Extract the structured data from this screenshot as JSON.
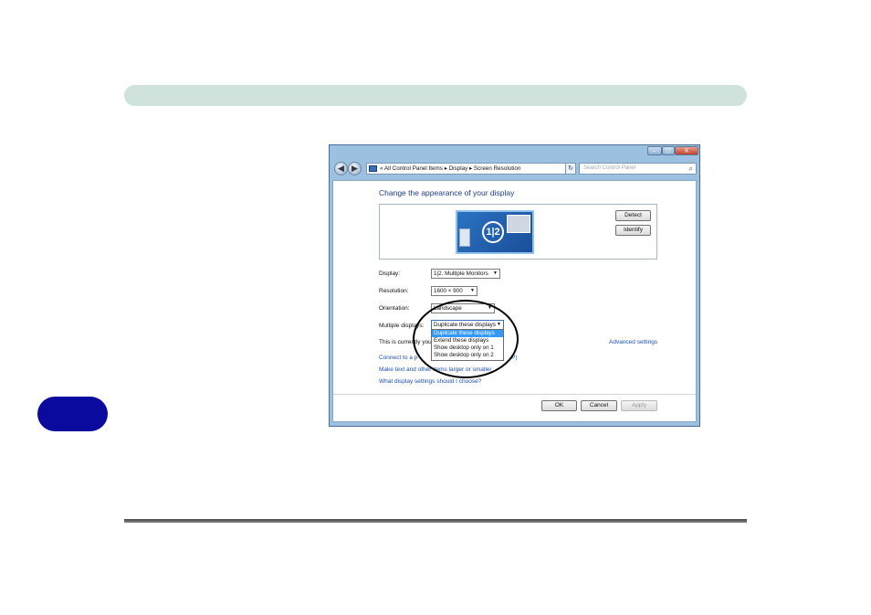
{
  "window": {
    "caption_buttons": {
      "minimize": "–",
      "maximize": "□",
      "close": "X"
    },
    "address_bar": {
      "back": "◀",
      "forward": "▶",
      "path": "«  All Control Panel Items  ▸  Display  ▸  Screen Resolution",
      "dropdown": "▾",
      "refresh": "↻",
      "search_placeholder": "Search Control Panel",
      "search_icon": "⌕"
    },
    "page_title": "Change the appearance of your display",
    "preview": {
      "badge": "1|2"
    },
    "buttons": {
      "detect": "Detect",
      "identify": "Identify",
      "ok": "OK",
      "cancel": "Cancel",
      "apply": "Apply"
    },
    "display": {
      "label": "Display:",
      "value": "1|2. Multiple Monitors"
    },
    "resolution": {
      "label": "Resolution:",
      "value": "1600 × 900"
    },
    "orientation": {
      "label": "Orientation:",
      "value": "Landscape"
    },
    "multiple_displays": {
      "label": "Multiple displays:",
      "value": "Duplicate these displays",
      "options": [
        "Duplicate these displays",
        "Extend these displays",
        "Show desktop only on 1",
        "Show desktop only on 2"
      ]
    },
    "info_text": "This is currently you",
    "links": {
      "advanced": "Advanced settings",
      "connect": "Connect to a p",
      "connect_tail": "P)",
      "text_size": "Make text and other items larger or smaller",
      "choose": "What display settings should I choose?"
    }
  },
  "colors": {
    "header_bar": "#cfe2dc",
    "chapter_tab": "#0a0a9e",
    "link": "#1a4fb8",
    "selection": "#3399ff"
  }
}
